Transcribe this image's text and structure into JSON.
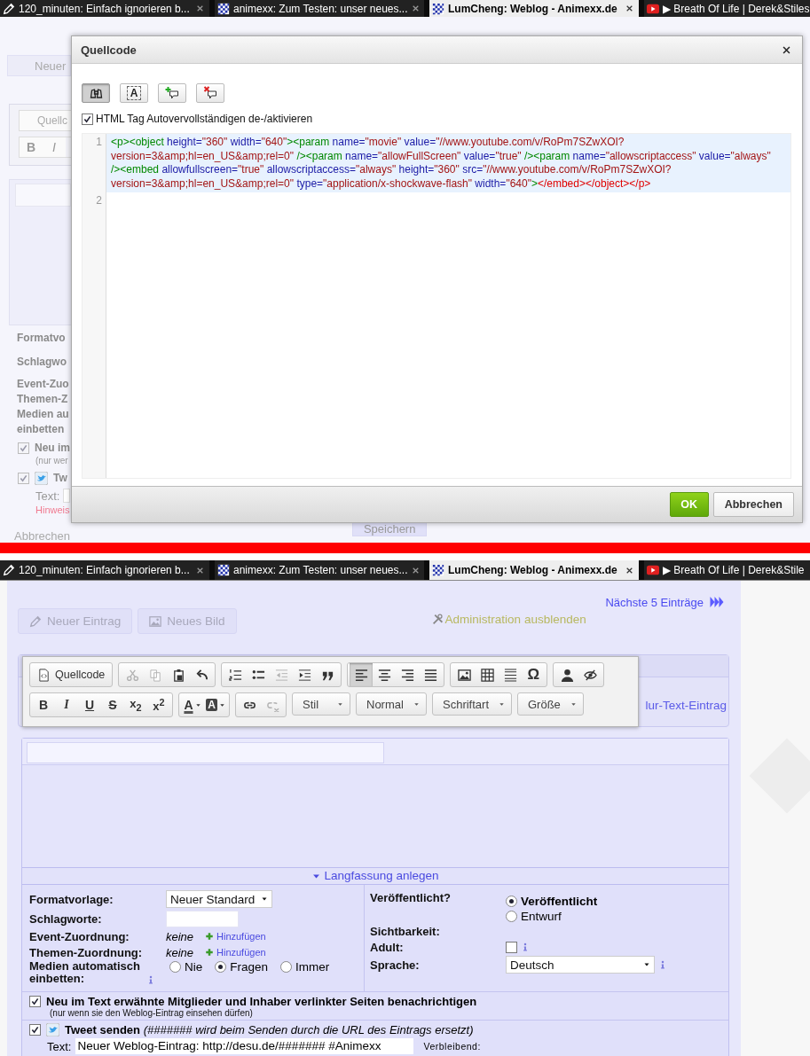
{
  "top_capture": {
    "tabs": [
      {
        "kind": "pencil",
        "label": "120_minuten: Einfach ignorieren b...",
        "selected": false
      },
      {
        "kind": "pattern",
        "label": "animexx: Zum Testen: unser neues...",
        "selected": false
      },
      {
        "kind": "pattern",
        "label": "LumCheng: Weblog - Animexx.de",
        "selected": true
      },
      {
        "kind": "video",
        "label": "▶ Breath Of Life | Derek&Stiles",
        "selected": false
      }
    ],
    "background": {
      "new_button": "Neuer",
      "source_button": "Quellc",
      "format_buttons": [
        "B",
        "I"
      ],
      "labels": [
        "Formatvo",
        "Schlagwo",
        "Event-Zuo",
        "Themen-Z",
        "Medien au",
        "einbetten"
      ],
      "notify": {
        "checked": true,
        "label": "Neu im",
        "note": "(nur wer"
      },
      "tweet": {
        "checked": true,
        "label": "Tw",
        "text_label": "Text:",
        "hint": "Hinweis"
      },
      "cancel": "Abbrechen",
      "save": "Speichern"
    },
    "dialog": {
      "title": "Quellcode",
      "tools": [
        {
          "kind": "binoculars",
          "selected": true
        },
        {
          "kind": "letter-box",
          "label": "A",
          "selected": false
        },
        {
          "kind": "comment-add",
          "selected": false
        },
        {
          "kind": "comment-remove",
          "selected": false
        }
      ],
      "autocomplete": {
        "label": "HTML Tag Autovervollständigen de-/aktivieren",
        "checked": true
      },
      "code_lines": [
        {
          "number": "1",
          "active": true,
          "tokens": [
            {
              "kind": "tag",
              "text": "<p><object"
            },
            {
              "kind": "attr",
              "text": " height="
            },
            {
              "kind": "value",
              "text": "\"360\""
            },
            {
              "kind": "attr",
              "text": " width="
            },
            {
              "kind": "value",
              "text": "\"640\""
            },
            {
              "kind": "tag",
              "text": "><param"
            },
            {
              "kind": "attr",
              "text": " name="
            },
            {
              "kind": "value",
              "text": "\"movie\""
            },
            {
              "kind": "attr",
              "text": " value="
            },
            {
              "kind": "value",
              "text": "\"//www.youtube.com/v/RoPm7SZwXOI?version=3&amp;hl=en_US&amp;rel=0\""
            },
            {
              "kind": "tag",
              "text": " /><param"
            },
            {
              "kind": "attr",
              "text": " name="
            },
            {
              "kind": "value",
              "text": "\"allowFullScreen\""
            },
            {
              "kind": "attr",
              "text": " value="
            },
            {
              "kind": "value",
              "text": "\"true\""
            },
            {
              "kind": "tag",
              "text": " /><param"
            },
            {
              "kind": "attr",
              "text": " name="
            },
            {
              "kind": "value",
              "text": "\"allowscriptaccess\""
            },
            {
              "kind": "attr",
              "text": " value="
            },
            {
              "kind": "value",
              "text": "\"always\""
            },
            {
              "kind": "tag",
              "text": " /><embed"
            },
            {
              "kind": "attr",
              "text": " allowfullscreen="
            },
            {
              "kind": "value",
              "text": "\"true\""
            },
            {
              "kind": "attr",
              "text": " allowscriptaccess="
            },
            {
              "kind": "value",
              "text": "\"always\""
            },
            {
              "kind": "attr",
              "text": " height="
            },
            {
              "kind": "value",
              "text": "\"360\""
            },
            {
              "kind": "attr",
              "text": " src="
            },
            {
              "kind": "value",
              "text": "\"//www.youtube.com/v/RoPm7SZwXOI?version=3&amp;hl=en_US&amp;rel=0\""
            },
            {
              "kind": "attr",
              "text": " type="
            },
            {
              "kind": "value",
              "text": "\"application/x-shockwave-flash\""
            },
            {
              "kind": "attr",
              "text": " width="
            },
            {
              "kind": "value",
              "text": "\"640\""
            },
            {
              "kind": "tag",
              "text": ">"
            },
            {
              "kind": "close",
              "text": "</embed></object></p>"
            }
          ]
        },
        {
          "number": "2",
          "active": false
        }
      ],
      "buttons": [
        {
          "kind": "primary",
          "label": "OK"
        },
        {
          "kind": "secondary",
          "label": "Abbrechen"
        }
      ]
    }
  },
  "bottom_capture": {
    "tabs": [
      {
        "kind": "pencil",
        "label": "120_minuten: Einfach ignorieren b...",
        "selected": false
      },
      {
        "kind": "pattern",
        "label": "animexx: Zum Testen: unser neues...",
        "selected": false
      },
      {
        "kind": "pattern",
        "label": "LumCheng: Weblog - Animexx.de",
        "selected": true
      },
      {
        "kind": "video",
        "label": "▶ Breath Of Life | Derek&Stile",
        "selected": false
      }
    ],
    "next_link": "Nächste 5 Einträge",
    "actions": [
      {
        "kind": "pencil",
        "label": "Neuer Eintrag",
        "disabled": true
      },
      {
        "kind": "image",
        "label": "Neues Bild",
        "disabled": true
      }
    ],
    "admin_toggle": "Administration ausblenden",
    "text_entry_link": "lur-Text-Eintrag",
    "toolbar": [
      [
        {
          "kind": "group",
          "buttons": [
            {
              "kind": "source",
              "label": "Quellcode",
              "disabled": false
            }
          ]
        },
        {
          "kind": "group",
          "buttons": [
            {
              "kind": "cut",
              "disabled": true
            },
            {
              "kind": "copy",
              "disabled": true
            },
            {
              "kind": "paste",
              "disabled": false
            },
            {
              "kind": "undo",
              "disabled": false
            }
          ]
        },
        {
          "kind": "group",
          "buttons": [
            {
              "kind": "numbered-list",
              "disabled": false
            },
            {
              "kind": "bullet-list",
              "disabled": false
            },
            {
              "kind": "outdent",
              "disabled": true
            },
            {
              "kind": "indent",
              "disabled": false
            },
            {
              "kind": "blockquote",
              "disabled": false
            }
          ]
        },
        {
          "kind": "group",
          "buttons": [
            {
              "kind": "align-left",
              "disabled": false,
              "selected": true
            },
            {
              "kind": "align-center",
              "disabled": false,
              "selected": false
            },
            {
              "kind": "align-right",
              "disabled": false,
              "selected": false
            },
            {
              "kind": "justify",
              "disabled": false,
              "selected": false
            }
          ]
        },
        {
          "kind": "group",
          "buttons": [
            {
              "kind": "image",
              "disabled": false
            },
            {
              "kind": "table",
              "disabled": false
            },
            {
              "kind": "hr",
              "disabled": false
            },
            {
              "kind": "special-char",
              "label": "Ω",
              "disabled": false
            }
          ]
        },
        {
          "kind": "group",
          "buttons": [
            {
              "kind": "person",
              "disabled": false
            },
            {
              "kind": "eye-slash",
              "disabled": false
            }
          ]
        }
      ],
      [
        {
          "kind": "group",
          "buttons": [
            {
              "kind": "bold",
              "label": "B",
              "disabled": false
            },
            {
              "kind": "italic",
              "label": "I",
              "disabled": false
            },
            {
              "kind": "underline",
              "label": "U",
              "disabled": false
            },
            {
              "kind": "strike",
              "label": "S",
              "disabled": false
            },
            {
              "kind": "subscript",
              "label": "x$_{2}$",
              "disabled": false
            },
            {
              "kind": "superscript",
              "label": "x$^{2}$",
              "disabled": false
            }
          ]
        },
        {
          "kind": "group",
          "buttons": [
            {
              "kind": "text-color",
              "label": "A",
              "disabled": false
            },
            {
              "kind": "bg-color",
              "label": "A",
              "disabled": false
            }
          ]
        },
        {
          "kind": "group",
          "buttons": [
            {
              "kind": "link",
              "disabled": false
            },
            {
              "kind": "unlink",
              "disabled": true
            }
          ]
        },
        {
          "kind": "dropdown",
          "label": "Stil"
        },
        {
          "kind": "dropdown",
          "label": "Normal"
        },
        {
          "kind": "dropdown",
          "label": "Schriftart"
        },
        {
          "kind": "dropdown",
          "label": "Größe"
        }
      ]
    ],
    "expand_link": "Langfassung anlegen",
    "form": {
      "format": {
        "label": "Formatvorlage:",
        "value": "Neuer Standard"
      },
      "tags": {
        "label": "Schlagworte:"
      },
      "assignments": [
        {
          "label": "Event-Zuordnung:",
          "value": "keine",
          "action": "Hinzufügen"
        },
        {
          "label": "Themen-Zuordnung:",
          "value": "keine",
          "action": "Hinzufügen"
        }
      ],
      "embed": {
        "label": "Medien automatisch einbetten:",
        "options": [
          {
            "label": "Nie",
            "selected": false
          },
          {
            "label": "Fragen",
            "selected": true
          },
          {
            "label": "Immer",
            "selected": false
          }
        ]
      },
      "publish": {
        "label": "Veröffentlicht?",
        "options": [
          {
            "label": "Veröffentlicht",
            "selected": true
          },
          {
            "label": "Entwurf",
            "selected": false
          }
        ]
      },
      "visibility": {
        "label": "Sichtbarkeit:"
      },
      "adult": {
        "label": "Adult:",
        "checked": false
      },
      "language": {
        "label": "Sprache:",
        "value": "Deutsch"
      }
    },
    "notify": {
      "checked": true,
      "label": "Neu im Text erwähnte Mitglieder und Inhaber verlinkter Seiten benachrichtigen",
      "note": "(nur wenn sie den Weblog-Eintrag einsehen dürfen)"
    },
    "tweet": {
      "checked": true,
      "label": "**Tweet senden** *(####### wird beim Senden durch die URL des Eintrags ersetzt)*",
      "text_label": "Text:",
      "value": "Neuer Weblog-Eintrag: http://desu.de/####### #Animexx",
      "remaining_label": "Verbleibend:"
    }
  }
}
